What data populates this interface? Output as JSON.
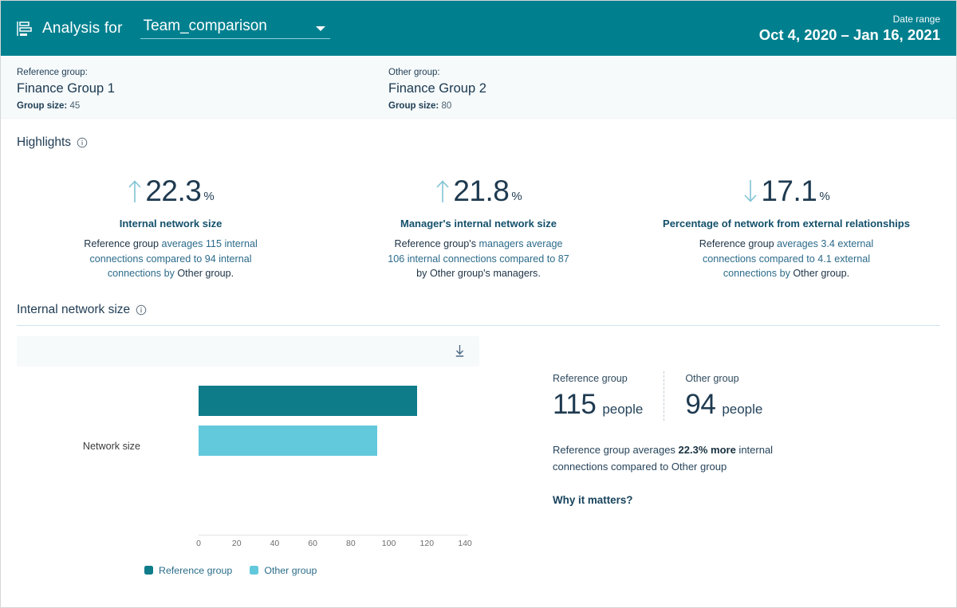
{
  "header": {
    "icon": "report-icon",
    "title": "Analysis for",
    "dropdown_value": "Team_comparison",
    "dropdown_caret": "chevron-down-icon",
    "date_label": "Date range",
    "date_value": "Oct 4, 2020 – Jan 16, 2021",
    "background": "#00808f"
  },
  "groups": [
    {
      "kicker": "Reference group:",
      "name": "Finance Group 1",
      "size_label": "Group size:",
      "size_value": "45"
    },
    {
      "kicker": "Other group:",
      "name": "Finance Group 2",
      "size_label": "Group size:",
      "size_value": "80"
    }
  ],
  "highlights_section": {
    "title": "Highlights",
    "info_icon": "info-icon",
    "items": [
      {
        "direction": "up",
        "arrow_icon": "arrow-up-icon",
        "value": "22.3",
        "unit": "%",
        "name": "Internal network size",
        "desc_part1": "Reference group",
        "desc_part2": " averages 115 internal connections compared to 94 internal connections by ",
        "desc_part3": "Other group."
      },
      {
        "direction": "up",
        "arrow_icon": "arrow-up-icon",
        "value": "21.8",
        "unit": "%",
        "name": "Manager's internal network size",
        "desc_part1": "Reference group's",
        "desc_part2": " managers average 106 internal connections compared to 87 ",
        "desc_part3": "by Other group's managers."
      },
      {
        "direction": "down",
        "arrow_icon": "arrow-down-icon",
        "value": "17.1",
        "unit": "%",
        "name": "Percentage of network from external relationships",
        "desc_part1": "Reference group",
        "desc_part2": " averages 3.4 external connections compared to 4.1 external connections by ",
        "desc_part3": "Other group."
      }
    ]
  },
  "internal_network_section": {
    "title": "Internal network size",
    "info_icon": "info-icon",
    "toolbar": {
      "download_icon": "download-icon"
    },
    "stats": [
      {
        "label": "Reference group",
        "number": "115",
        "unit": "people"
      },
      {
        "label": "Other group",
        "number": "94",
        "unit": "people"
      }
    ],
    "summary_part1": "Reference group averages ",
    "summary_bold": "22.3% more",
    "summary_part2": " internal connections compared to Other group",
    "why_link": "Why it matters?"
  },
  "chart_data": {
    "type": "bar",
    "orientation": "horizontal",
    "title": "Internal network size",
    "categories": [
      "Network size"
    ],
    "series": [
      {
        "name": "Reference group",
        "values": [
          115
        ],
        "color": "#0f7c8a"
      },
      {
        "name": "Other group",
        "values": [
          94
        ],
        "color": "#62c8dc"
      }
    ],
    "xlabel": "",
    "ylabel": "",
    "xlim": [
      0,
      140
    ],
    "xticks": [
      0,
      20,
      40,
      60,
      80,
      100,
      120,
      140
    ],
    "xtick_labels": [
      "0",
      "20",
      "40",
      "60",
      "80",
      "100",
      "120",
      "140"
    ],
    "grid": false,
    "legend_position": "bottom",
    "legend": [
      "Reference group",
      "Other group"
    ]
  }
}
